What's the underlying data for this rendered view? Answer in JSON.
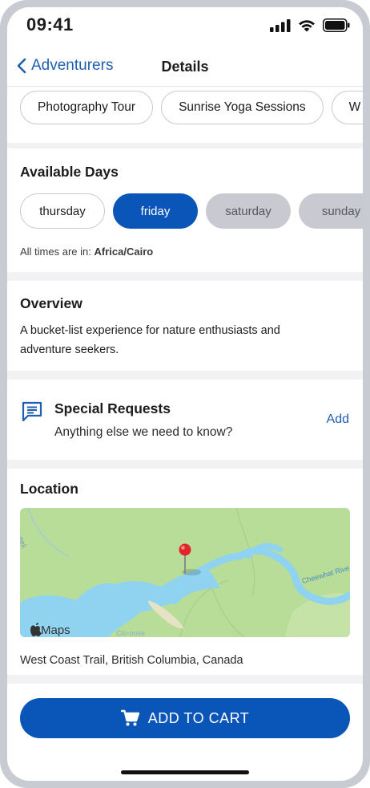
{
  "status": {
    "time": "09:41"
  },
  "nav": {
    "back_label": "Adventurers",
    "title": "Details"
  },
  "activities": [
    "Photography Tour",
    "Sunrise Yoga Sessions",
    "W"
  ],
  "available_days": {
    "title": "Available Days",
    "days": [
      {
        "label": "thursday",
        "state": "available"
      },
      {
        "label": "friday",
        "state": "selected"
      },
      {
        "label": "saturday",
        "state": "unavailable"
      },
      {
        "label": "sunday",
        "state": "unavailable"
      }
    ],
    "timezone_prefix": "All times are in:",
    "timezone": "Africa/Cairo"
  },
  "overview": {
    "title": "Overview",
    "text": "A bucket-list experience for nature enthusiasts and adventure seekers."
  },
  "special_requests": {
    "title": "Special Requests",
    "subtitle": "Anything else we need to know?",
    "action": "Add"
  },
  "location": {
    "title": "Location",
    "address": "West Coast Trail, British Columbia, Canada",
    "map": {
      "brand": "Maps",
      "labels": [
        "Cheewhat Rive",
        "Clo-oose",
        "eek"
      ]
    }
  },
  "cta": {
    "label": "ADD TO CART"
  },
  "colors": {
    "accent": "#0a55b8",
    "link": "#1f5fb0",
    "pin": "#e0262a",
    "water": "#8fd3f0",
    "land": "#b7dd98"
  }
}
